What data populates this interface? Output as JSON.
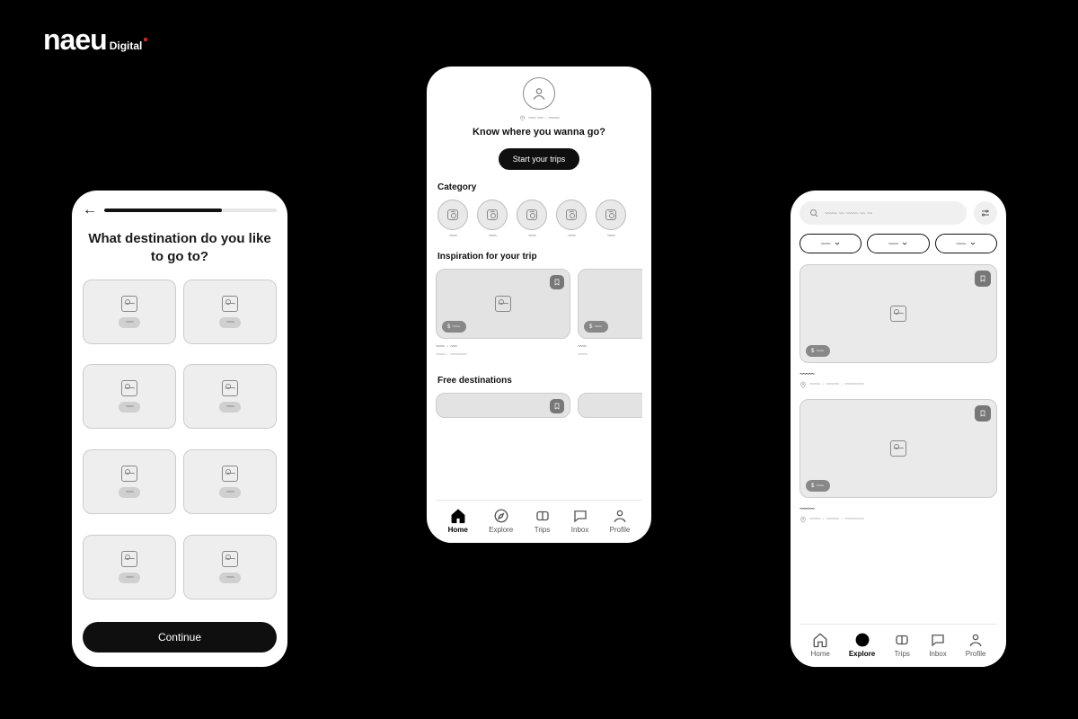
{
  "brand": {
    "main": "naeu",
    "sub": "Digital"
  },
  "phone1": {
    "title": "What destination do you like to go to?",
    "cta": "Continue",
    "cards": 8
  },
  "phone2": {
    "headline": "Know where you wanna go?",
    "startButton": "Start your trips",
    "categoryTitle": "Category",
    "inspirationTitle": "Inspiration for your trip",
    "freeTitle": "Free destinations",
    "priceIndicator": "$",
    "nav": {
      "home": "Home",
      "explore": "Explore",
      "trips": "Trips",
      "inbox": "Inbox",
      "profile": "Profile"
    }
  },
  "phone3": {
    "priceIndicator": "$",
    "nav": {
      "home": "Home",
      "explore": "Explore",
      "trips": "Trips",
      "inbox": "Inbox",
      "profile": "Profile"
    }
  }
}
